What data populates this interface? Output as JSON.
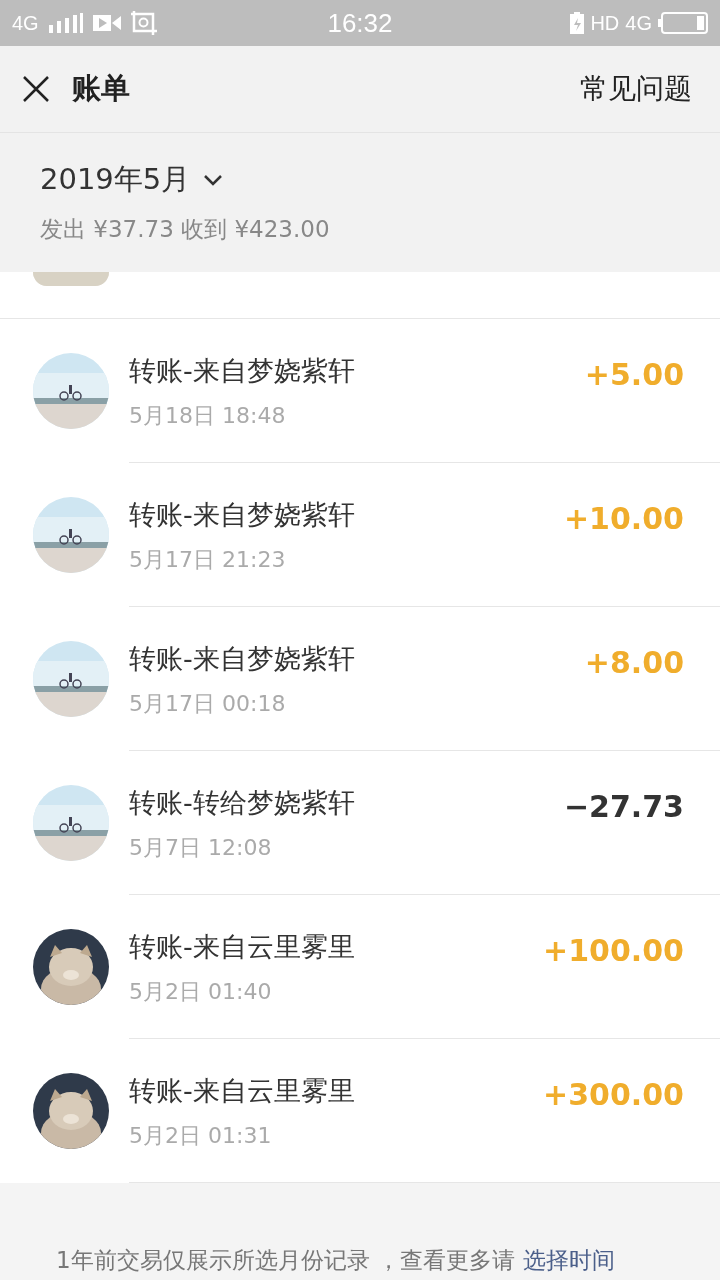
{
  "status_bar": {
    "network": "4G",
    "time": "16:32",
    "hd": "HD",
    "network_right": "4G"
  },
  "header": {
    "title": "账单",
    "help": "常见问题"
  },
  "summary": {
    "month": "2019年5月",
    "totals": "发出 ¥37.73 收到 ¥423.00"
  },
  "transactions": [
    {
      "title": "转账-来自梦娆紫轩",
      "date": "5月18日 18:48",
      "amount": "+5.00",
      "kind": "income"
    },
    {
      "title": "转账-来自梦娆紫轩",
      "date": "5月17日 21:23",
      "amount": "+10.00",
      "kind": "income"
    },
    {
      "title": "转账-来自梦娆紫轩",
      "date": "5月17日 00:18",
      "amount": "+8.00",
      "kind": "income"
    },
    {
      "title": "转账-转给梦娆紫轩",
      "date": "5月7日 12:08",
      "amount": "−27.73",
      "kind": "expense"
    },
    {
      "title": "转账-来自云里雾里",
      "date": "5月2日 01:40",
      "amount": "+100.00",
      "kind": "income"
    },
    {
      "title": "转账-来自云里雾里",
      "date": "5月2日 01:31",
      "amount": "+300.00",
      "kind": "income"
    }
  ],
  "footer": {
    "note": "1年前交易仅展示所选月份记录 ，查看更多请",
    "link": "选择时间"
  }
}
